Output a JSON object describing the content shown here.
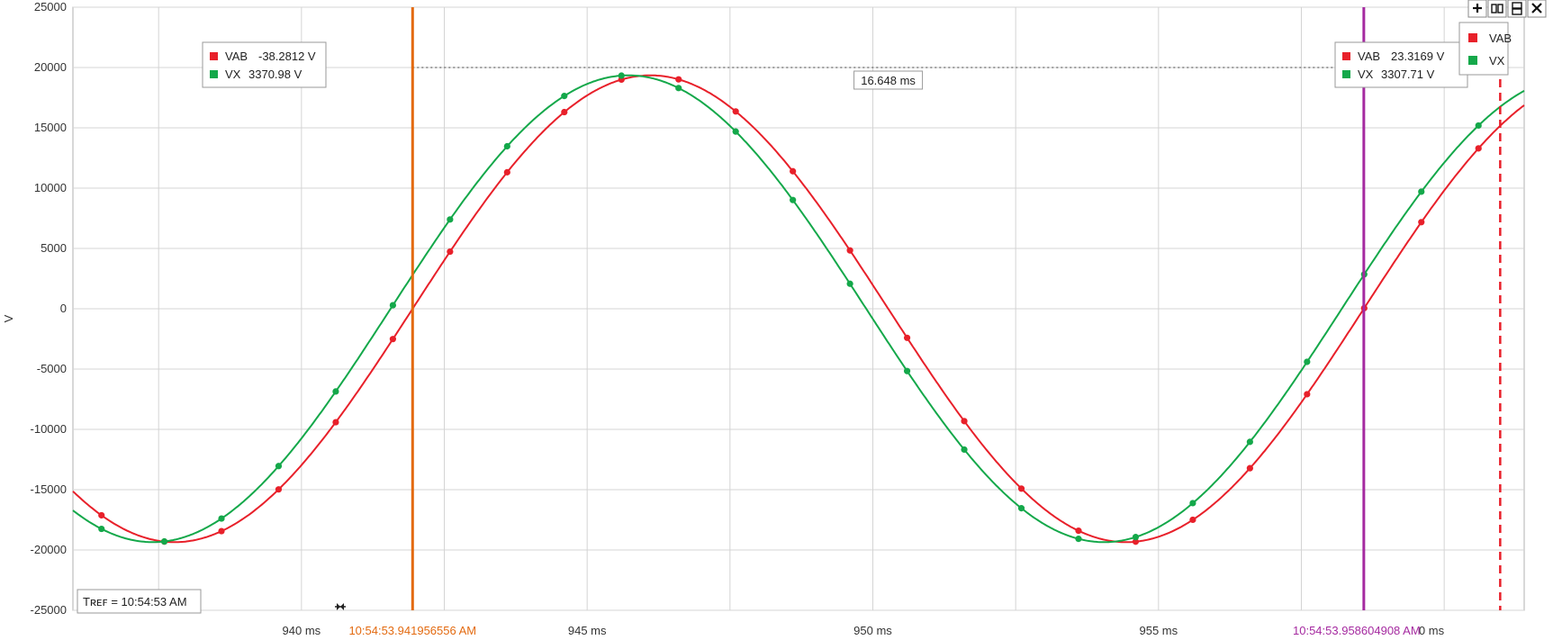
{
  "chart_data": {
    "type": "line",
    "ylabel": "V",
    "xlabel": "",
    "xlim": [
      936.0,
      961.4
    ],
    "ylim": [
      -25000,
      25000
    ],
    "grid": true,
    "legend_position": "top-right",
    "y_ticks": [
      "25000",
      "20000",
      "15000",
      "10000",
      "5000",
      "0",
      "-5000",
      "-10000",
      "-15000",
      "-20000",
      "-25000"
    ],
    "y_tick_values": [
      25000,
      20000,
      15000,
      10000,
      5000,
      0,
      -5000,
      -10000,
      -15000,
      -20000,
      -25000
    ],
    "x_ticks": [
      "940 ms",
      "945 ms",
      "950 ms",
      "955 ms"
    ],
    "x_tick_values": [
      940,
      945,
      950,
      955
    ],
    "x_tick_partial": "0 ms",
    "series": [
      {
        "name": "VAB",
        "color": "#e8202a",
        "amplitude": 19350,
        "period_ms": 16.648,
        "zero_cross_ms": 941.945,
        "markers_x": [
          936.5,
          937.6,
          938.6,
          939.6,
          940.6,
          941.6,
          942.6,
          943.6,
          944.6,
          945.6,
          946.6,
          947.6,
          948.6,
          949.6,
          950.6,
          951.6,
          952.6,
          953.6,
          954.6,
          955.6,
          956.6,
          957.6,
          958.6,
          959.6,
          960.6
        ]
      },
      {
        "name": "VX",
        "color": "#14a84a",
        "amplitude": 19350,
        "period_ms": 16.648,
        "zero_cross_ms": 941.56,
        "markers_x": [
          936.5,
          937.6,
          938.6,
          939.6,
          940.6,
          941.6,
          942.6,
          943.6,
          944.6,
          945.6,
          946.6,
          947.6,
          948.6,
          949.6,
          950.6,
          951.6,
          952.6,
          953.6,
          954.6,
          955.6,
          956.6,
          957.6,
          958.6,
          959.6,
          960.6
        ]
      }
    ],
    "cursors": [
      {
        "id": "cursor-1",
        "x": 941.945,
        "color": "#e36a10",
        "time_label": "10:54:53.941956556 AM",
        "readout": [
          {
            "series": "VAB",
            "value": "-38.2812 V"
          },
          {
            "series": "VX",
            "value": "3370.98 V"
          }
        ]
      },
      {
        "id": "cursor-2",
        "x": 958.593,
        "color": "#a52aa0",
        "time_label": "10:54:53.958604908 AM",
        "readout": [
          {
            "series": "VAB",
            "value": "23.3169 V"
          },
          {
            "series": "VX",
            "value": "3307.71 V"
          }
        ]
      }
    ],
    "delta": {
      "label": "16.648 ms",
      "y": 20000
    },
    "dashed_marker": {
      "x": 960.98,
      "color": "#e8202a"
    },
    "tref": "Tʀᴇꜰ = 10:54:53 AM"
  },
  "legend": {
    "items": [
      {
        "label": "VAB",
        "color": "#e8202a"
      },
      {
        "label": "VX",
        "color": "#14a84a"
      }
    ]
  },
  "toolbar": {
    "add_icon": "plus-icon",
    "columns_icon": "split-columns-icon",
    "rows_icon": "split-rows-icon",
    "close_icon": "close-icon"
  }
}
